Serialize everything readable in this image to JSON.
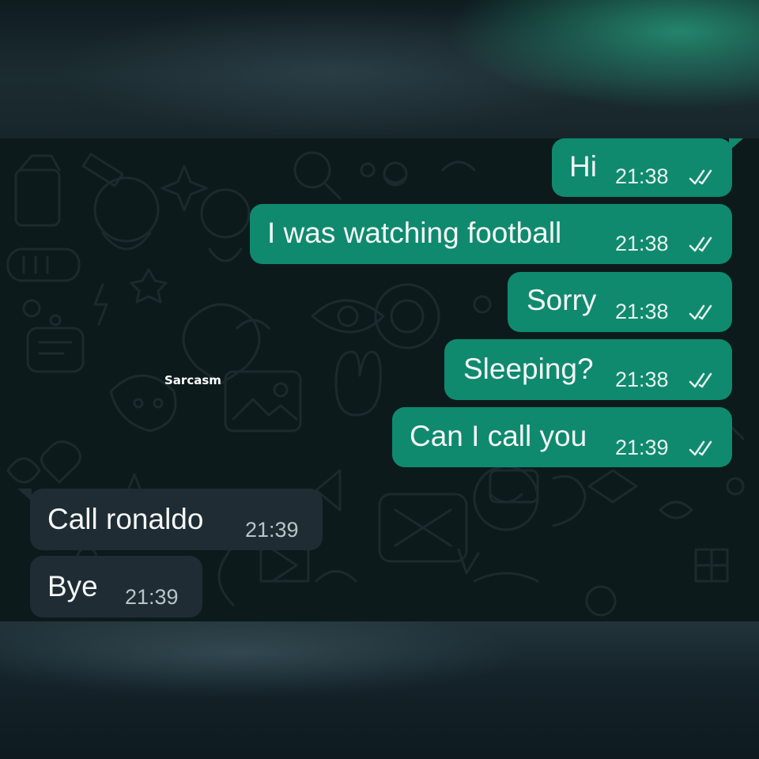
{
  "watermark": "Sarcasm",
  "colors": {
    "outgoing_bubble": "#0f8a6e",
    "incoming_bubble": "#1f2c33",
    "chat_background": "#0d1a1c"
  },
  "messages": [
    {
      "direction": "outgoing",
      "text": "Hi",
      "time": "21:38",
      "status_icon": "double-check-icon"
    },
    {
      "direction": "outgoing",
      "text": "I was watching football",
      "time": "21:38",
      "status_icon": "double-check-icon"
    },
    {
      "direction": "outgoing",
      "text": "Sorry",
      "time": "21:38",
      "status_icon": "double-check-icon"
    },
    {
      "direction": "outgoing",
      "text": "Sleeping?",
      "time": "21:38",
      "status_icon": "double-check-icon"
    },
    {
      "direction": "outgoing",
      "text": "Can I call you",
      "time": "21:39",
      "status_icon": "double-check-icon"
    },
    {
      "direction": "incoming",
      "text": "Call ronaldo",
      "time": "21:39"
    },
    {
      "direction": "incoming",
      "text": "Bye",
      "time": "21:39"
    }
  ]
}
